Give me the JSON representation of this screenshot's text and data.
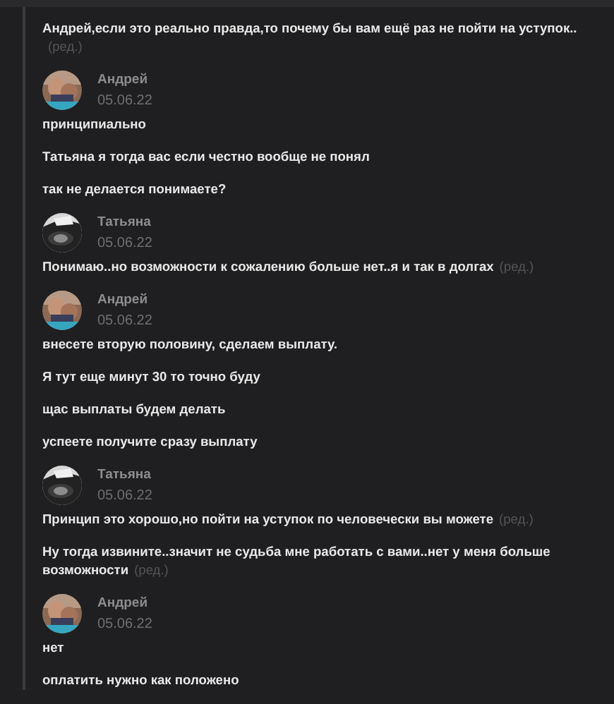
{
  "groups": [
    {
      "messages": [
        {
          "text": "Андрей,если это реально правда,то почему бы вам ещё раз не пойти на уступок..",
          "edited_label": "(ред.)"
        }
      ]
    },
    {
      "author": "Андрей",
      "date": "05.06.22",
      "messages": [
        {
          "text": "принципиально"
        },
        {
          "text": "Татьяна я тогда вас если честно вообще не понял"
        },
        {
          "text": "так не делается понимаете?"
        }
      ]
    },
    {
      "author": "Татьяна",
      "date": "05.06.22",
      "messages": [
        {
          "text": "Понимаю..но возможности к сожалению больше нет..я и так в долгах",
          "edited_label": "(ред.)"
        }
      ]
    },
    {
      "author": "Андрей",
      "date": "05.06.22",
      "messages": [
        {
          "text": "внесете вторую половину, сделаем выплату."
        },
        {
          "text": "Я тут еще минут 30 то точно буду"
        },
        {
          "text": "щас выплаты будем делать"
        },
        {
          "text": "успеете получите сразу выплату"
        }
      ]
    },
    {
      "author": "Татьяна",
      "date": "05.06.22",
      "messages": [
        {
          "text": "Принцип это хорошо,но пойти на уступок по человечески вы можете",
          "edited_label": "(ред.)"
        },
        {
          "text": "Ну тогда извините..значит не судьба мне работать с вами..нет у меня больше возможности",
          "edited_label": "(ред.)"
        }
      ]
    },
    {
      "author": "Андрей",
      "date": "05.06.22",
      "messages": [
        {
          "text": "нет"
        },
        {
          "text": "оплатить нужно как положено"
        }
      ]
    }
  ]
}
